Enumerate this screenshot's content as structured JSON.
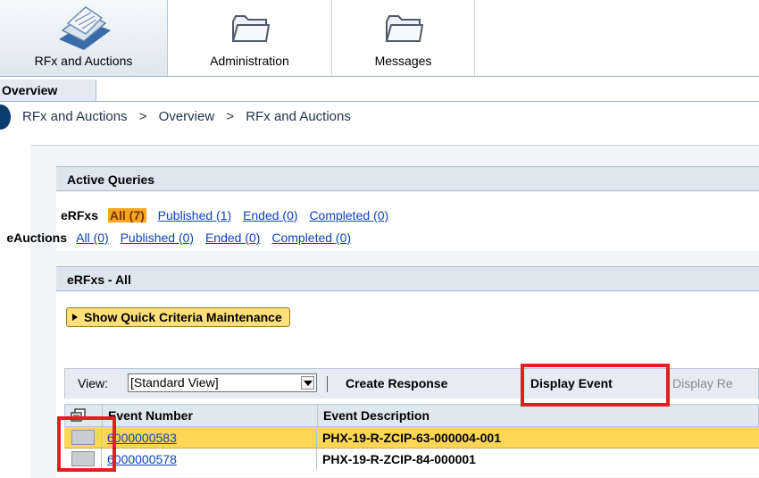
{
  "nav": {
    "tabs": [
      {
        "label": "RFx and Auctions",
        "icon": "documents-stack-icon"
      },
      {
        "label": "Administration",
        "icon": "folder-icon"
      },
      {
        "label": "Messages",
        "icon": "folder-icon"
      }
    ],
    "subtab": "Overview"
  },
  "breadcrumb": [
    "RFx and Auctions",
    ">",
    "Overview",
    ">",
    "RFx and Auctions"
  ],
  "active_queries": {
    "title": "Active Queries",
    "erfx": {
      "label": "eRFxs",
      "links": [
        "All (7)",
        "Published (1)",
        "Ended (0)",
        "Completed (0)"
      ]
    },
    "eauctions": {
      "label": "eAuctions",
      "links": [
        "All (0)",
        "Published (0)",
        "Ended (0)",
        "Completed (0)"
      ]
    }
  },
  "erfx_all": {
    "title": "eRFxs - All",
    "quick_criteria_button": "Show Quick Criteria Maintenance",
    "toolbar": {
      "view_label": "View:",
      "view_value": "[Standard View]",
      "create_response": "Create Response",
      "display_event": "Display Event",
      "display_response": "Display Re"
    },
    "columns": [
      "Event Number",
      "Event Description"
    ],
    "rows": [
      {
        "event_number": "6000000583",
        "event_description": "PHX-19-R-ZCIP-63-000004-001"
      },
      {
        "event_number": "6000000578",
        "event_description": "PHX-19-R-ZCIP-84-000001"
      }
    ]
  },
  "colors": {
    "selected_row": "#fdd655",
    "highlight_box": "#e02020",
    "link": "#0b44b6",
    "selected_filter": "#f6a623"
  }
}
